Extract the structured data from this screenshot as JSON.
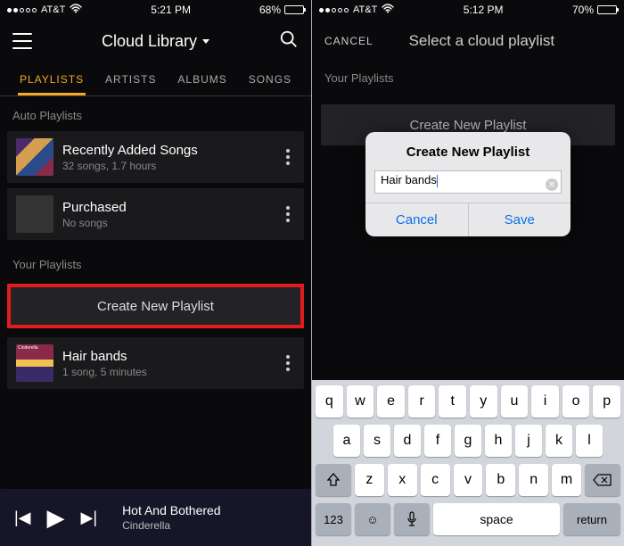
{
  "left": {
    "status": {
      "carrier": "AT&T",
      "time": "5:21 PM",
      "battery": "68%"
    },
    "header": {
      "title": "Cloud Library"
    },
    "tabs": [
      "PLAYLISTS",
      "ARTISTS",
      "ALBUMS",
      "SONGS"
    ],
    "active_tab": "PLAYLISTS",
    "sections": {
      "auto": {
        "label": "Auto Playlists",
        "items": [
          {
            "title": "Recently Added Songs",
            "sub": "32 songs, 1.7 hours"
          },
          {
            "title": "Purchased",
            "sub": "No songs"
          }
        ]
      },
      "your": {
        "label": "Your Playlists",
        "create": "Create New Playlist",
        "items": [
          {
            "title": "Hair bands",
            "sub": "1 song, 5 minutes"
          }
        ]
      }
    },
    "now_playing": {
      "title": "Hot And Bothered",
      "artist": "Cinderella"
    }
  },
  "right": {
    "status": {
      "carrier": "AT&T",
      "time": "5:12 PM",
      "battery": "70%"
    },
    "header": {
      "cancel": "CANCEL",
      "title": "Select a cloud playlist"
    },
    "section_label": "Your Playlists",
    "create": "Create New Playlist",
    "dialog": {
      "title": "Create New Playlist",
      "input_value": "Hair bands",
      "cancel": "Cancel",
      "save": "Save"
    },
    "keyboard": {
      "r1": [
        "q",
        "w",
        "e",
        "r",
        "t",
        "y",
        "u",
        "i",
        "o",
        "p"
      ],
      "r2": [
        "a",
        "s",
        "d",
        "f",
        "g",
        "h",
        "j",
        "k",
        "l"
      ],
      "r3": [
        "z",
        "x",
        "c",
        "v",
        "b",
        "n",
        "m"
      ],
      "numkey": "123",
      "space": "space",
      "return": "return"
    }
  }
}
